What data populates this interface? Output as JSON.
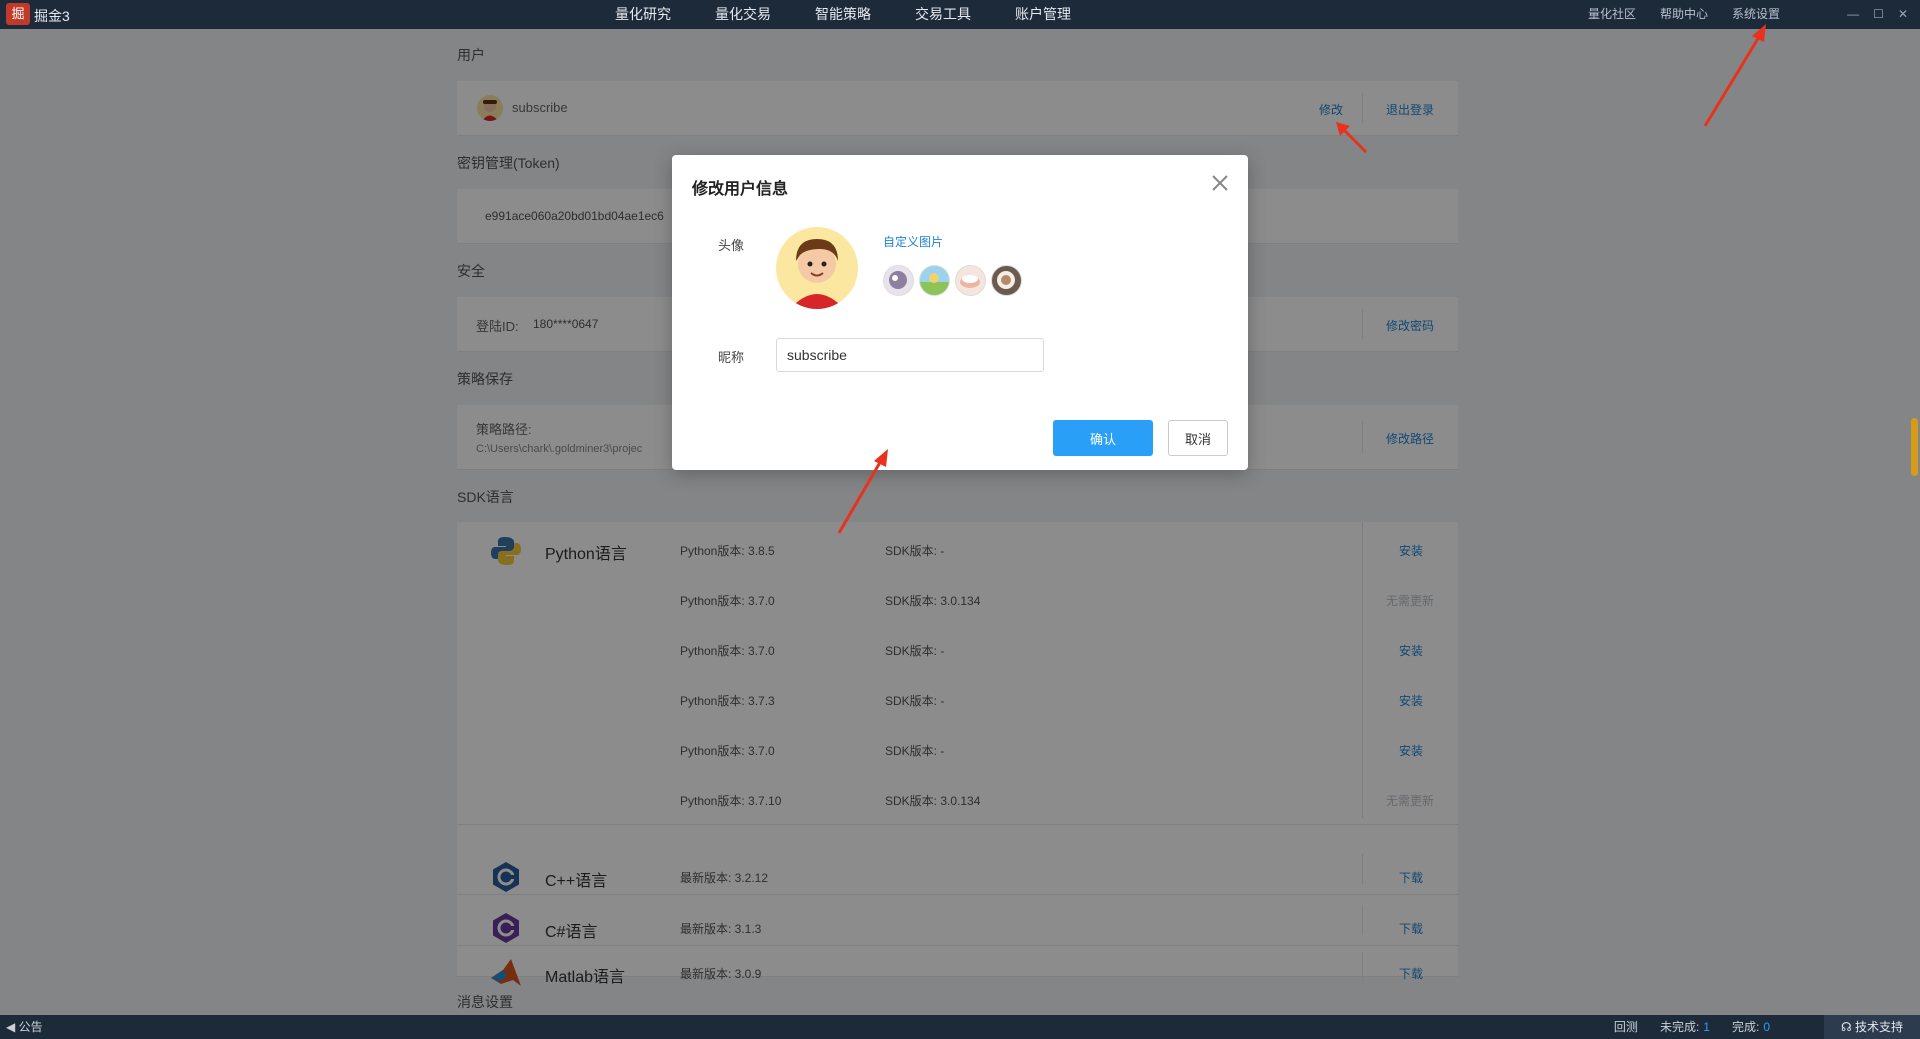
{
  "app": {
    "name": "掘金3",
    "logo_char": "掘"
  },
  "nav": {
    "items": [
      "量化研究",
      "量化交易",
      "智能策略",
      "交易工具",
      "账户管理"
    ]
  },
  "top_right": {
    "community": "量化社区",
    "help": "帮助中心",
    "settings": "系统设置"
  },
  "window_controls": {
    "minimize": "—",
    "maximize": "☐",
    "close": "✕"
  },
  "sections": {
    "user": {
      "title": "用户",
      "username": "subscribe",
      "edit": "修改",
      "logout": "退出登录"
    },
    "token": {
      "title": "密钥管理(Token)",
      "value": "e991ace060a20bd01bd04ae1ec6"
    },
    "security": {
      "title": "安全",
      "login_id_label": "登陆ID:",
      "login_id": "180****0647",
      "change_password": "修改密码"
    },
    "strategy": {
      "title": "策略保存",
      "path_label": "策略路径:",
      "path_value": "C:\\Users\\chark\\.goldminer3\\projec",
      "change_path": "修改路径"
    },
    "sdk": {
      "title": "SDK语言",
      "python": {
        "name": "Python语言",
        "rows": [
          {
            "version": "Python版本: 3.8.5",
            "sdk": "SDK版本: -",
            "action": "安装",
            "enabled": true
          },
          {
            "version": "Python版本: 3.7.0",
            "sdk": "SDK版本: 3.0.134",
            "action": "无需更新",
            "enabled": false
          },
          {
            "version": "Python版本: 3.7.0",
            "sdk": "SDK版本: -",
            "action": "安装",
            "enabled": true
          },
          {
            "version": "Python版本: 3.7.3",
            "sdk": "SDK版本: -",
            "action": "安装",
            "enabled": true
          },
          {
            "version": "Python版本: 3.7.0",
            "sdk": "SDK版本: -",
            "action": "安装",
            "enabled": true
          },
          {
            "version": "Python版本: 3.7.10",
            "sdk": "SDK版本: 3.0.134",
            "action": "无需更新",
            "enabled": false
          }
        ]
      },
      "cpp": {
        "name": "C++语言",
        "version": "最新版本: 3.2.12",
        "action": "下载"
      },
      "csharp": {
        "name": "C#语言",
        "version": "最新版本: 3.1.3",
        "action": "下载"
      },
      "matlab": {
        "name": "Matlab语言",
        "version": "最新版本: 3.0.9",
        "action": "下载"
      }
    },
    "message": {
      "title": "消息设置"
    }
  },
  "modal": {
    "title": "修改用户信息",
    "avatar_label": "头像",
    "custom_image": "自定义图片",
    "nickname_label": "昵称",
    "nickname_value": "subscribe",
    "confirm": "确认",
    "cancel": "取消"
  },
  "bottom": {
    "notice": "公告",
    "backtest": "回测",
    "incomplete_label": "未完成:",
    "incomplete": "1",
    "complete_label": "完成:",
    "complete": "0",
    "support": "技术支持"
  },
  "colors": {
    "accent": "#2a9ff7",
    "topbar": "#1d2a3a",
    "annotation": "#e8321e"
  }
}
